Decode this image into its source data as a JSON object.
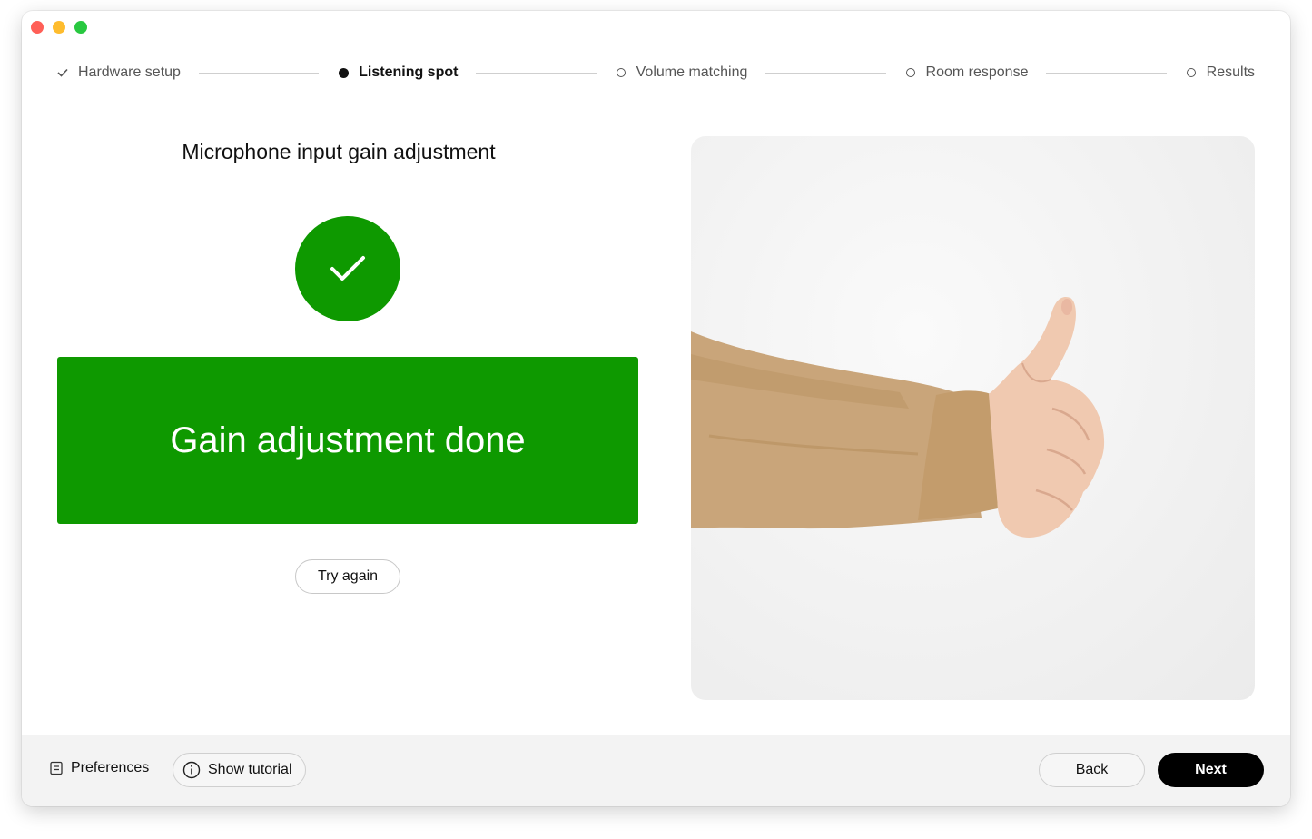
{
  "colors": {
    "success": "#0e9900",
    "primary_button": "#000000",
    "footer_bg": "#f3f3f3"
  },
  "stepper": {
    "steps": [
      {
        "label": "Hardware setup",
        "state": "completed",
        "icon": "check-icon"
      },
      {
        "label": "Listening spot",
        "state": "active",
        "icon": "filled-dot-icon"
      },
      {
        "label": "Volume matching",
        "state": "pending",
        "icon": "empty-circle-icon"
      },
      {
        "label": "Room response",
        "state": "pending",
        "icon": "empty-circle-icon"
      },
      {
        "label": "Results",
        "state": "pending",
        "icon": "empty-circle-icon"
      }
    ]
  },
  "main": {
    "title": "Microphone input gain adjustment",
    "status_icon": "checkmark-icon",
    "banner_text": "Gain adjustment done",
    "try_again_label": "Try again",
    "illustration": "thumbs-up-photo"
  },
  "footer": {
    "preferences_label": "Preferences",
    "preferences_icon": "document-icon",
    "tutorial_label": "Show tutorial",
    "tutorial_icon": "info-icon",
    "back_label": "Back",
    "next_label": "Next"
  }
}
